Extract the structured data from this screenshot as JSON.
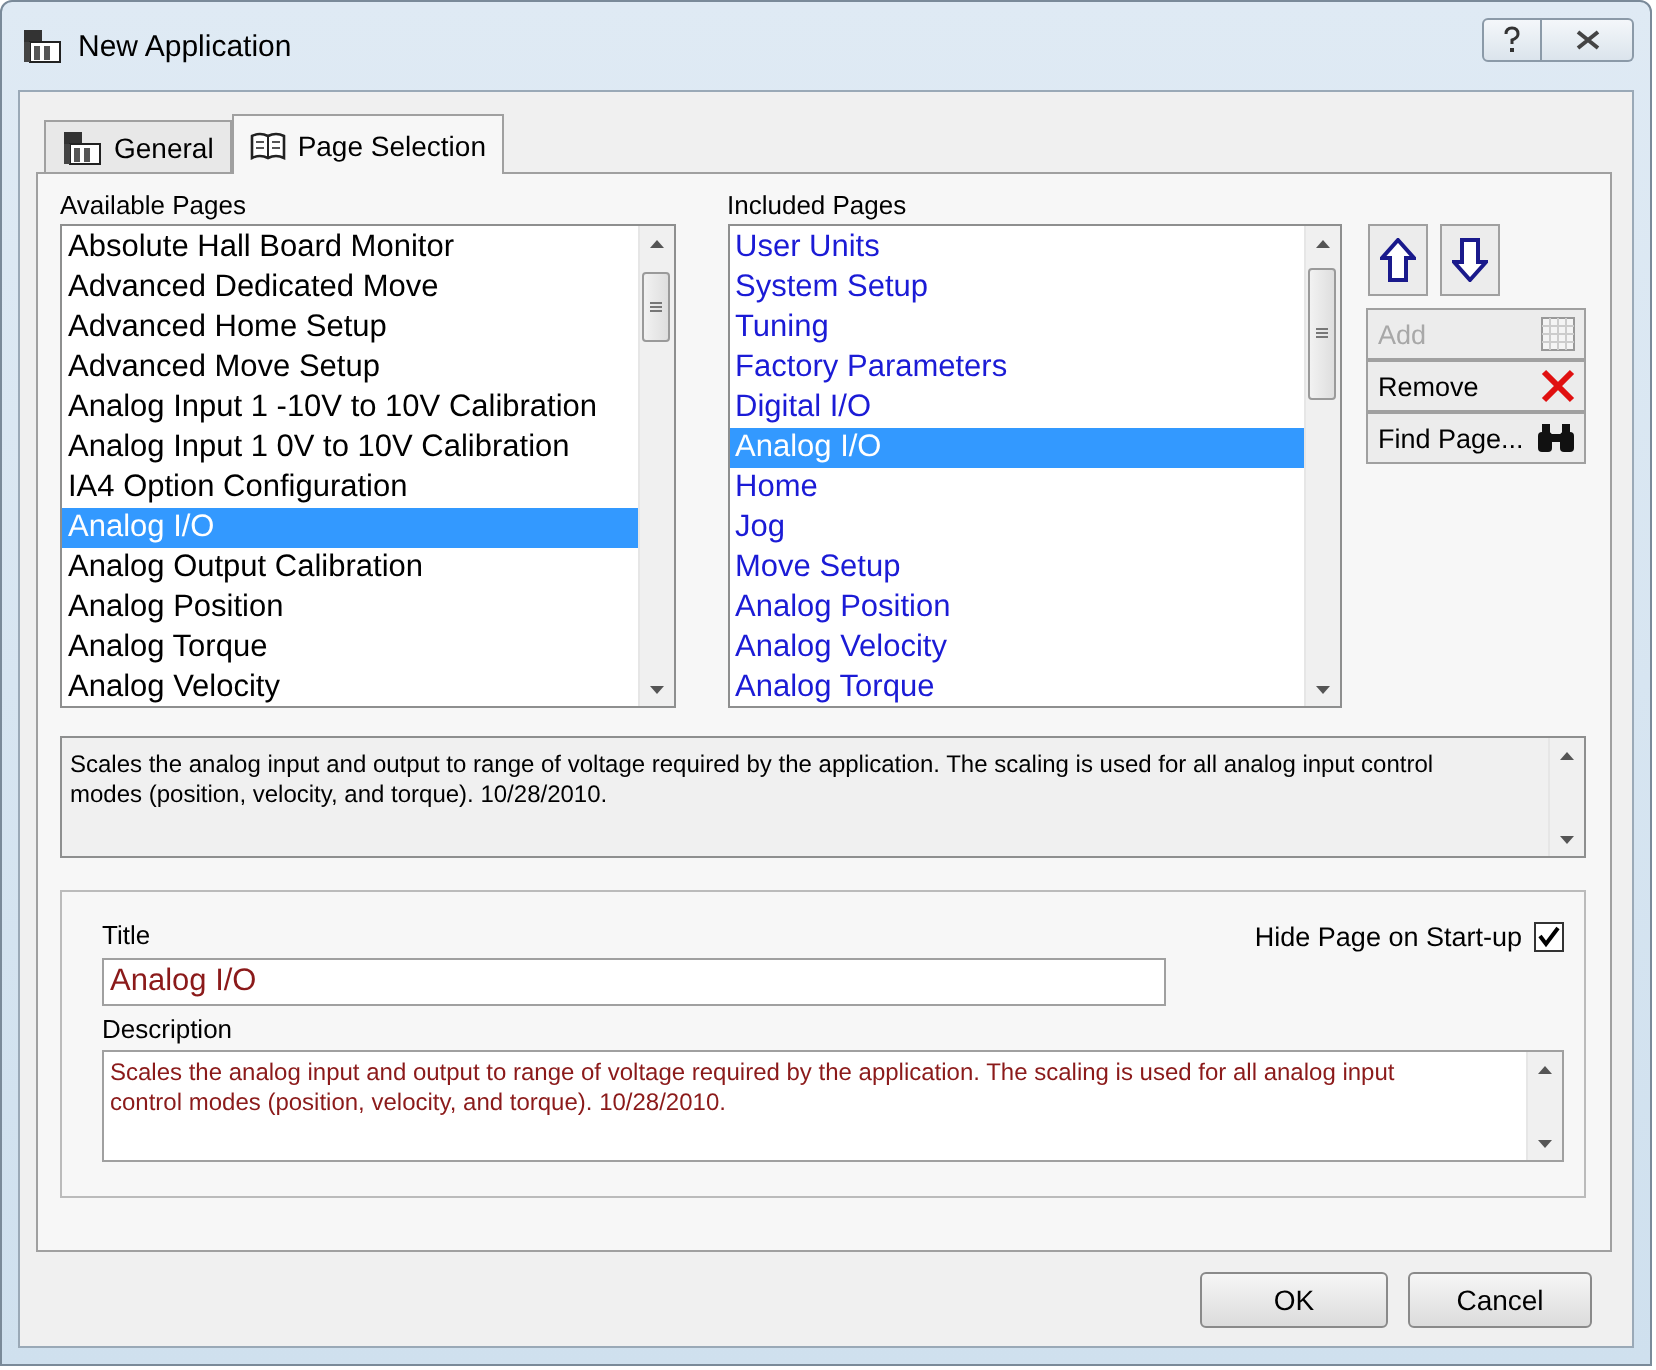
{
  "window": {
    "title": "New Application"
  },
  "tabs": [
    {
      "label": "General",
      "selected": false,
      "kind": "general"
    },
    {
      "label": "Page Selection",
      "selected": true,
      "kind": "book"
    }
  ],
  "available_pages": {
    "label": "Available Pages",
    "items": [
      {
        "label": "Absolute Hall Board Monitor",
        "selected": false
      },
      {
        "label": "Advanced Dedicated Move",
        "selected": false
      },
      {
        "label": "Advanced Home Setup",
        "selected": false
      },
      {
        "label": "Advanced Move Setup",
        "selected": false
      },
      {
        "label": "Analog Input 1 -10V to 10V Calibration",
        "selected": false
      },
      {
        "label": "Analog Input 1 0V to 10V Calibration",
        "selected": false
      },
      {
        "label": "IA4 Option Configuration",
        "selected": false
      },
      {
        "label": "Analog I/O",
        "selected": true
      },
      {
        "label": "Analog Output Calibration",
        "selected": false
      },
      {
        "label": "Analog Position",
        "selected": false
      },
      {
        "label": "Analog Torque",
        "selected": false
      },
      {
        "label": "Analog Velocity",
        "selected": false
      }
    ]
  },
  "included_pages": {
    "label": "Included Pages",
    "items": [
      {
        "label": "User Units",
        "selected": false
      },
      {
        "label": "System Setup",
        "selected": false
      },
      {
        "label": "Tuning",
        "selected": false
      },
      {
        "label": "Factory Parameters",
        "selected": false
      },
      {
        "label": "Digital I/O",
        "selected": false
      },
      {
        "label": "Analog I/O",
        "selected": true
      },
      {
        "label": "Home",
        "selected": false
      },
      {
        "label": "Jog",
        "selected": false
      },
      {
        "label": "Move Setup",
        "selected": false
      },
      {
        "label": "Analog Position",
        "selected": false
      },
      {
        "label": "Analog Velocity",
        "selected": false
      },
      {
        "label": "Analog Torque",
        "selected": false
      }
    ]
  },
  "side_buttons": [
    {
      "label": "Add",
      "disabled": true,
      "kind": "add"
    },
    {
      "label": "Remove",
      "disabled": false,
      "kind": "remove"
    },
    {
      "label": "Find Page...",
      "disabled": false,
      "kind": "find"
    }
  ],
  "summary": "Scales the analog input and output to range of voltage required by the application. The scaling is used for all analog input control modes (position, velocity, and torque).  10/28/2010.",
  "details": {
    "title_label": "Title",
    "title_value": "Analog I/O",
    "hide_label": "Hide Page on Start-up",
    "hide_checked": true,
    "description_label": "Description",
    "description_value": "Scales the analog input and output to range of voltage required by the application. The scaling is used for all analog input control modes (position, velocity, and torque).  10/28/2010."
  },
  "footer_buttons": [
    "OK",
    "Cancel"
  ]
}
